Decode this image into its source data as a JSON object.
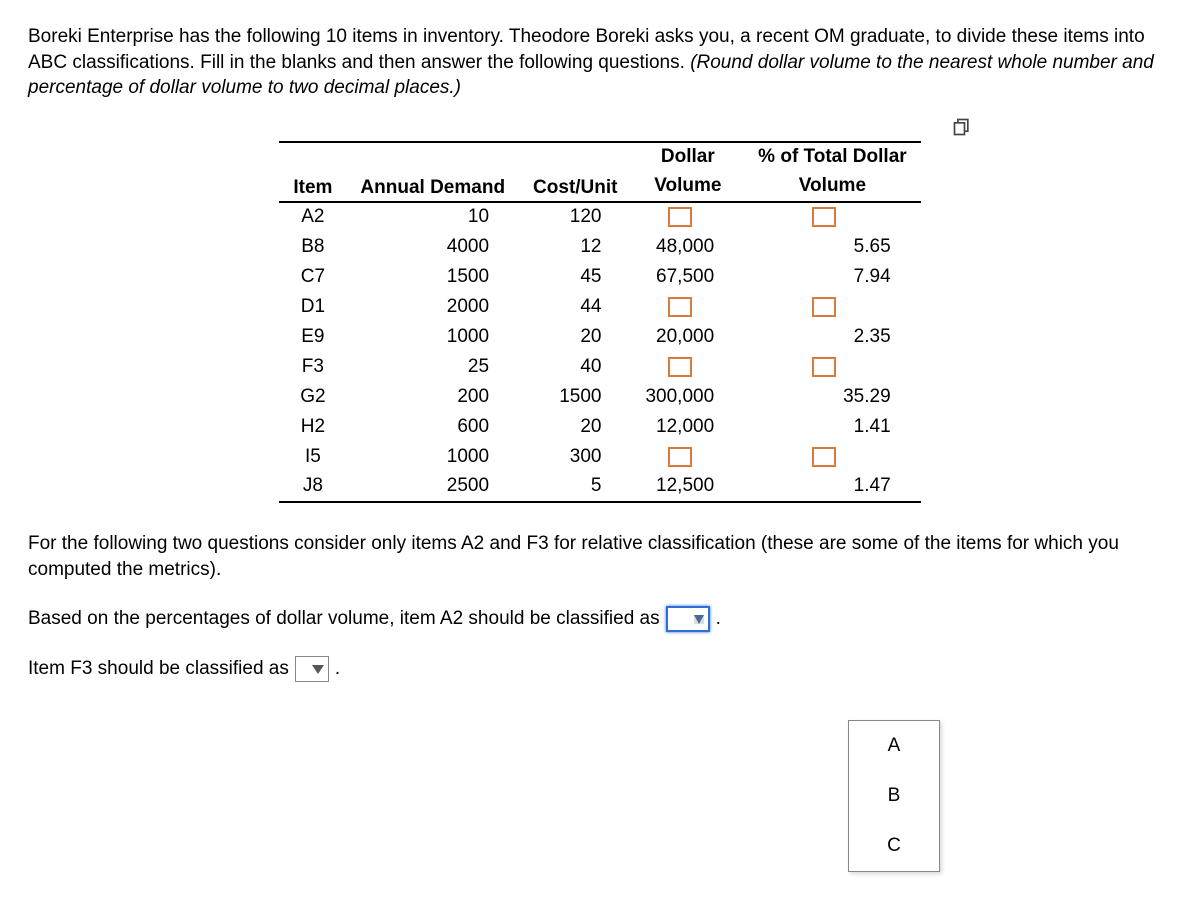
{
  "intro": {
    "part1": "Boreki Enterprise has the following 10 items in inventory.  Theodore Boreki asks you, a recent OM graduate, to divide these items into ABC classifications. Fill in the blanks and then answer the following questions. ",
    "italic": "(Round dollar volume to the nearest whole number and percentage of dollar volume to two decimal places.)"
  },
  "headers": {
    "item": "Item",
    "demand": "Annual Demand",
    "cost": "Cost/Unit",
    "dv_top": "Dollar",
    "dv_bot": "Volume",
    "pct_top": "% of Total Dollar",
    "pct_bot": "Volume"
  },
  "rows": [
    {
      "item": "A2",
      "demand": "10",
      "cost": "120",
      "dv": "",
      "pct": ""
    },
    {
      "item": "B8",
      "demand": "4000",
      "cost": "12",
      "dv": "48,000",
      "pct": "5.65"
    },
    {
      "item": "C7",
      "demand": "1500",
      "cost": "45",
      "dv": "67,500",
      "pct": "7.94"
    },
    {
      "item": "D1",
      "demand": "2000",
      "cost": "44",
      "dv": "",
      "pct": ""
    },
    {
      "item": "E9",
      "demand": "1000",
      "cost": "20",
      "dv": "20,000",
      "pct": "2.35"
    },
    {
      "item": "F3",
      "demand": "25",
      "cost": "40",
      "dv": "",
      "pct": ""
    },
    {
      "item": "G2",
      "demand": "200",
      "cost": "1500",
      "dv": "300,000",
      "pct": "35.29"
    },
    {
      "item": "H2",
      "demand": "600",
      "cost": "20",
      "dv": "12,000",
      "pct": "1.41"
    },
    {
      "item": "I5",
      "demand": "1000",
      "cost": "300",
      "dv": "",
      "pct": ""
    },
    {
      "item": "J8",
      "demand": "2500",
      "cost": "5",
      "dv": "12,500",
      "pct": "1.47"
    }
  ],
  "post": "For the following two questions consider only items A2 and F3 for relative classification (these are some of the items for which you computed the metrics).",
  "q1_pre": "Based on the percentages of dollar volume, item A2 should be classified as",
  "q2_pre": "Item F3 should be classified as",
  "period": ".",
  "options": [
    "A",
    "B",
    "C"
  ]
}
